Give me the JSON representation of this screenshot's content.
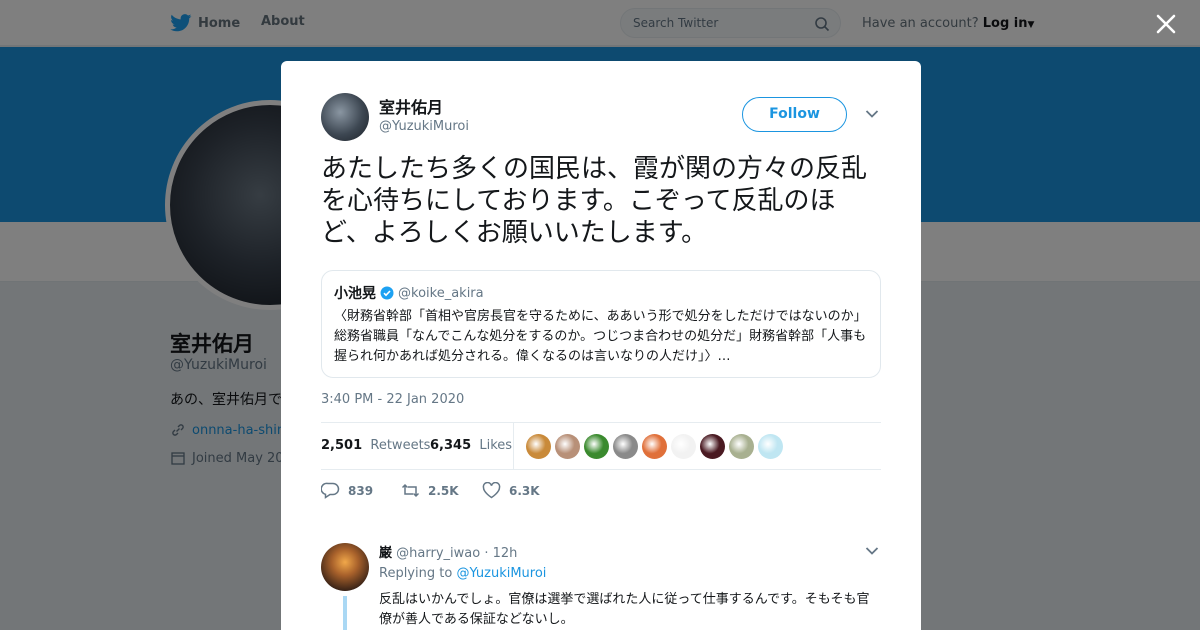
{
  "nav": {
    "home_label": "Home",
    "about_label": "About",
    "search_placeholder": "Search Twitter",
    "account_prompt": "Have an account?",
    "login_label": "Log in"
  },
  "profile": {
    "name": "室井佑月",
    "handle": "@YuzukiMuroi",
    "bio_snippet": "あの、室井佑月で",
    "link_snippet": "onnna-ha-shin",
    "joined_snippet": "Joined May 20"
  },
  "tweet": {
    "author_name": "室井佑月",
    "author_handle": "@YuzukiMuroi",
    "follow_label": "Follow",
    "text": "あたしたち多くの国民は、霞が関の方々の反乱を心待ちにしております。こぞって反乱のほど、よろしくお願いいたします。",
    "quote": {
      "name": "小池晃",
      "handle": "@koike_akira",
      "text": "〈財務省幹部「首相や官房長官を守るために、ああいう形で処分をしただけではないのか」総務省職員「なんでこんな処分をするのか。つじつま合わせの処分だ」財務省幹部「人事も握られ何かあれば処分される。偉くなるのは言いなりの人だけ」〉…"
    },
    "timestamp": "3:40 PM - 22 Jan 2020",
    "stats": {
      "retweets_count": "2,501",
      "retweets_label": "Retweets",
      "likes_count": "6,345",
      "likes_label": "Likes"
    },
    "liker_colors": [
      "#c98a3a",
      "#b89078",
      "#3a8a2e",
      "#8a8a8a",
      "#e0703a",
      "#f2f2f2",
      "#4a1a22",
      "#a8b090",
      "#bfe6f2"
    ],
    "actions": {
      "reply_count": "839",
      "retweet_count": "2.5K",
      "like_count": "6.3K"
    }
  },
  "reply": {
    "name": "巌",
    "handle": "@harry_iwao",
    "time": "· 12h",
    "replying_prefix": "Replying to",
    "replying_to": "@YuzukiMuroi",
    "text": "反乱はいかんでしょ。官僚は選挙で選ばれた人に従って仕事するんです。そもそも官僚が善人である保証などないし。"
  },
  "colors": {
    "accent": "#1b95e0",
    "banner": "#1b95e0"
  }
}
